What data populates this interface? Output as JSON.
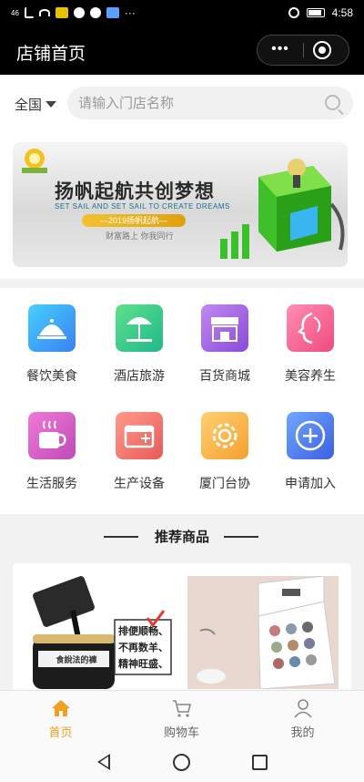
{
  "status_bar": {
    "left_text": "46",
    "time": "4:58"
  },
  "nav": {
    "title": "店铺首页",
    "more_symbol": "•••"
  },
  "search": {
    "region": "全国",
    "placeholder": "请输入门店名称"
  },
  "banner": {
    "logo_text": "扬帆",
    "headline": "扬帆起航共创梦想",
    "subline": "SET SAIL AND SET SAIL TO CREATE DREAMS",
    "ribbon": "—2019扬帆起航—",
    "slogan": "财富路上 你我同行"
  },
  "categories": [
    {
      "label": "餐饮美食",
      "icon": "dining-cloche-icon",
      "color": "#3aa7f0"
    },
    {
      "label": "酒店旅游",
      "icon": "beach-umbrella-icon",
      "color": "#27c98f"
    },
    {
      "label": "百货商城",
      "icon": "storefront-icon",
      "color": "#9b59d9"
    },
    {
      "label": "美容养生",
      "icon": "beauty-face-icon",
      "color": "#f05a8f"
    },
    {
      "label": "生活服务",
      "icon": "coffee-cup-icon",
      "color": "#d44fb0"
    },
    {
      "label": "生产设备",
      "icon": "equipment-box-icon",
      "color": "#f07070"
    },
    {
      "label": "厦门台协",
      "icon": "gear-icon",
      "color": "#f5b040"
    },
    {
      "label": "申请加入",
      "icon": "plus-circle-icon",
      "color": "#3d6fe0"
    }
  ],
  "recommend": {
    "title": "推荐商品"
  },
  "products": [
    {
      "name_label": "食說法的褲",
      "badge_lines": [
        "排便顺畅、",
        "不再数羊、",
        "精神旺盛、"
      ]
    },
    {
      "name_label": ""
    }
  ],
  "tabbar": [
    {
      "label": "首页",
      "active": true,
      "icon": "home-icon"
    },
    {
      "label": "购物车",
      "active": false,
      "icon": "cart-icon"
    },
    {
      "label": "我的",
      "active": false,
      "icon": "user-icon"
    }
  ],
  "colors": {
    "accent": "#f0a020",
    "inactive": "#666666"
  }
}
